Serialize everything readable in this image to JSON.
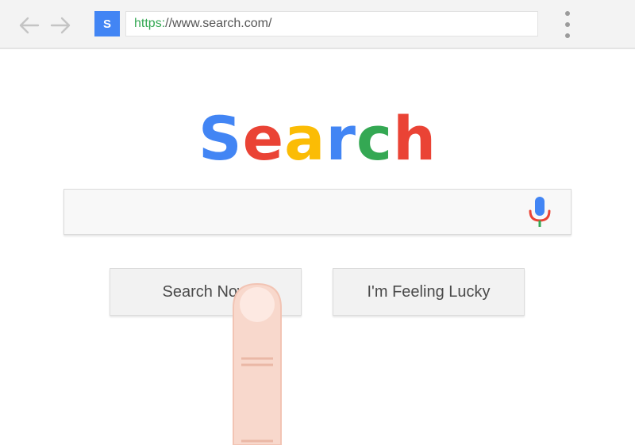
{
  "browser": {
    "back_icon": "arrow-left-icon",
    "forward_icon": "arrow-right-icon",
    "favicon_letter": "S",
    "url_scheme": "https:",
    "url_rest": "//www.search.com/",
    "menu_icon": "kebab-menu-icon"
  },
  "logo": {
    "letters": [
      {
        "char": "S",
        "color": "#4285f4"
      },
      {
        "char": "e",
        "color": "#ea4335"
      },
      {
        "char": "a",
        "color": "#fbbc05"
      },
      {
        "char": "r",
        "color": "#4285f4"
      },
      {
        "char": "c",
        "color": "#34a853"
      },
      {
        "char": "h",
        "color": "#ea4335"
      }
    ]
  },
  "search": {
    "value": "",
    "placeholder": "",
    "mic_icon": "microphone-icon"
  },
  "buttons": {
    "search_now": "Search Now",
    "feeling_lucky": "I'm Feeling Lucky"
  },
  "colors": {
    "blue": "#4285f4",
    "red": "#ea4335",
    "yellow": "#fbbc05",
    "green": "#34a853",
    "finger": "#f8d8cc"
  }
}
